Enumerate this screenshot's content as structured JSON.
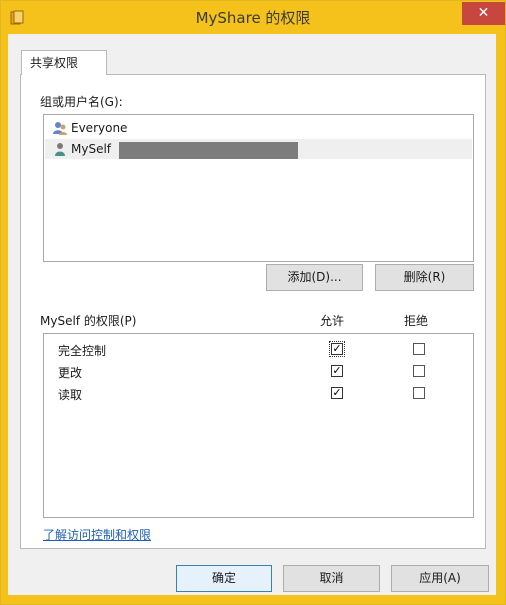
{
  "window": {
    "title": "MyShare 的权限",
    "close_glyph": "✕",
    "accent_color": "#f4c21a",
    "close_color": "#c7463d"
  },
  "tab": {
    "label": "共享权限"
  },
  "groups": {
    "label": "组或用户名(G):",
    "items": [
      {
        "name": "Everyone",
        "icon": "users-group-icon",
        "selected": false
      },
      {
        "name": "MySelf",
        "icon": "user-icon",
        "selected": true
      }
    ]
  },
  "buttons": {
    "add": "添加(D)...",
    "remove": "删除(R)",
    "ok": "确定",
    "cancel": "取消",
    "apply": "应用(A)"
  },
  "permissions": {
    "label": "MySelf 的权限(P)",
    "allow_header": "允许",
    "deny_header": "拒绝",
    "rows": [
      {
        "name": "完全控制",
        "allow": true,
        "deny": false
      },
      {
        "name": "更改",
        "allow": true,
        "deny": false
      },
      {
        "name": "读取",
        "allow": true,
        "deny": false
      }
    ]
  },
  "link": {
    "text": "了解访问控制和权限"
  }
}
